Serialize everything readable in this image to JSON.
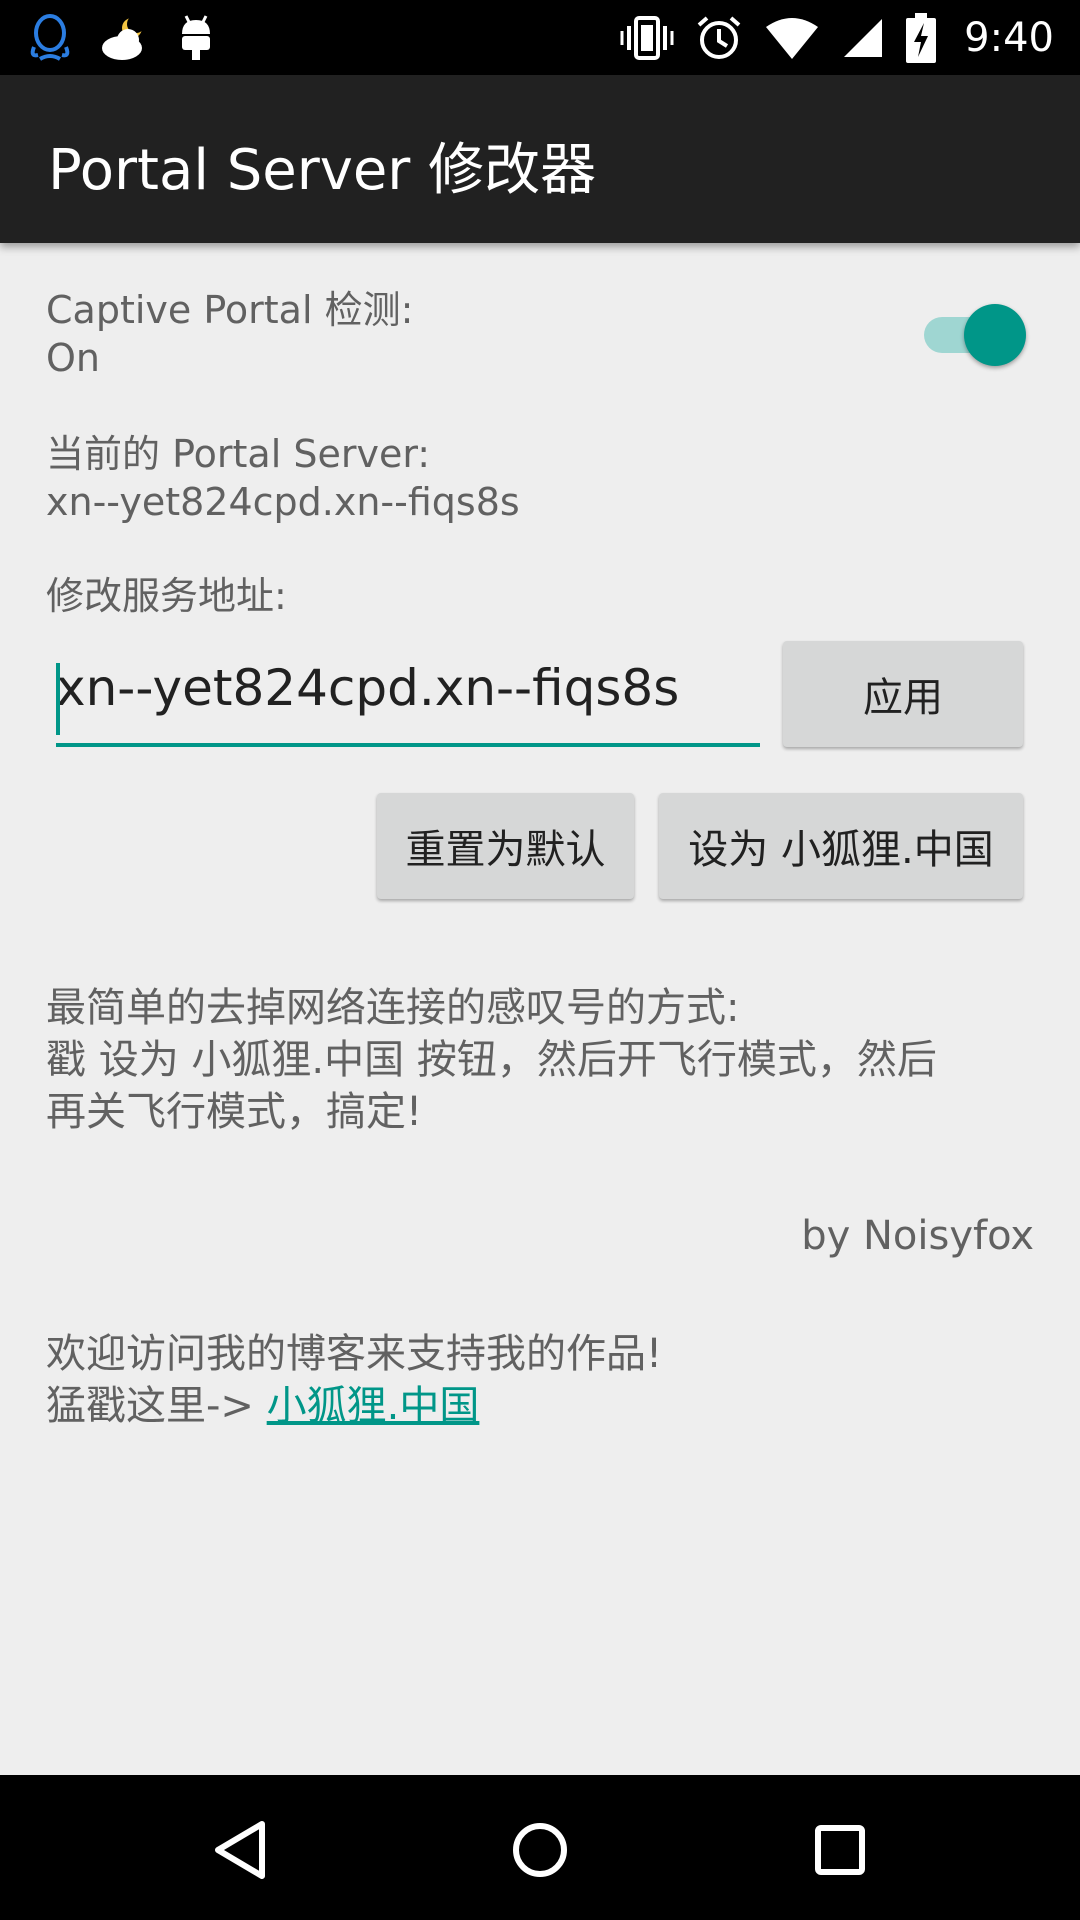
{
  "status_bar": {
    "time": "9:40",
    "left_icons": [
      "qq-icon",
      "weather-icon",
      "android-debug-icon"
    ],
    "right_icons": [
      "vibrate-icon",
      "alarm-icon",
      "wifi-icon",
      "signal-icon",
      "battery-charging-icon"
    ]
  },
  "app_bar": {
    "title": "Portal Server 修改器"
  },
  "captive_portal": {
    "label": "Captive Portal 检测:",
    "value": "On",
    "switch_on": true
  },
  "current_server": {
    "label": "当前的 Portal Server:",
    "value": "xn--yet824cpd.xn--fiqs8s"
  },
  "modify": {
    "label": "修改服务地址:",
    "input_value": "xn--yet824cpd.xn--fiqs8s",
    "apply_button": "应用",
    "reset_button": "重置为默认",
    "set_fox_button": "设为 小狐狸.中国"
  },
  "tips": {
    "lines": [
      "最简单的去掉网络连接的感叹号的方式:",
      "戳 设为 小狐狸.中国 按钮，然后开飞行模式，然后",
      "再关飞行模式，搞定!"
    ]
  },
  "credit": "by Noisyfox",
  "blog": {
    "line1": "欢迎访问我的博客来支持我的作品!",
    "line2_prefix": "猛戳这里-> ",
    "link_text": "小狐狸.中国"
  },
  "colors": {
    "accent": "#009688",
    "app_bar": "#212121",
    "background": "#eeeeee",
    "button": "#d6d7d7"
  }
}
